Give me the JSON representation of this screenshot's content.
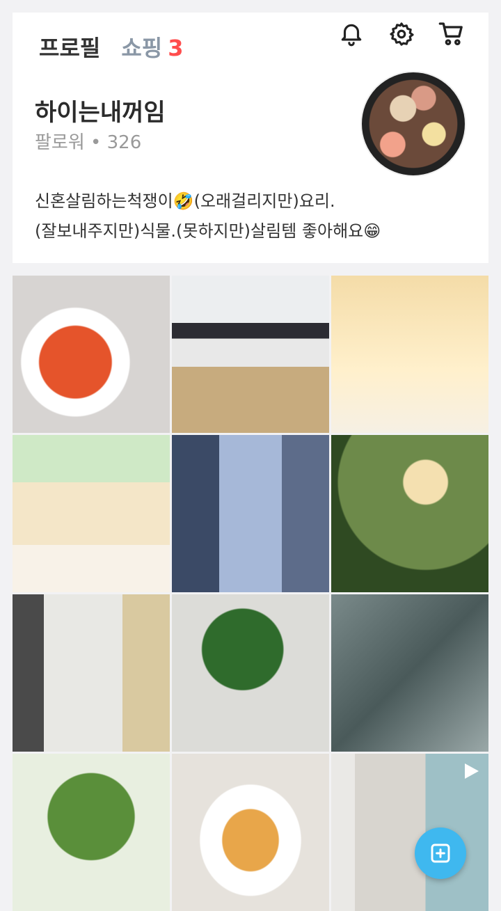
{
  "header": {
    "tab_profile": "프로필",
    "tab_shopping": "쇼핑",
    "shopping_count": "3",
    "icons": [
      "bell-icon",
      "gear-icon",
      "cart-icon"
    ]
  },
  "profile": {
    "name": "하이는내꺼임",
    "followers_label": "팔로워",
    "followers_count": "326",
    "bio_line1": "신혼살림하는척쟁이🤣(오래걸리지만)요리.",
    "bio_line2": "(잘보내주지만)식물.(못하지만)살림템 좋아해요😁"
  },
  "grid": {
    "tiles": [
      {
        "subject": "pasta-plate"
      },
      {
        "subject": "living-room"
      },
      {
        "subject": "game-screen-icecream"
      },
      {
        "subject": "game-screen-chick"
      },
      {
        "subject": "glass-cups"
      },
      {
        "subject": "plants-sunset"
      },
      {
        "subject": "blender-beans"
      },
      {
        "subject": "monstera-plant"
      },
      {
        "subject": "camping-chairs-stream"
      },
      {
        "subject": "tomato-plant"
      },
      {
        "subject": "spaghetti-dish"
      },
      {
        "subject": "blender-video",
        "is_video": true
      }
    ]
  },
  "fab": {
    "icon": "plus-square-icon"
  },
  "colors": {
    "shopping_count": "#ff4d4d",
    "fab": "#3fb8ef"
  }
}
